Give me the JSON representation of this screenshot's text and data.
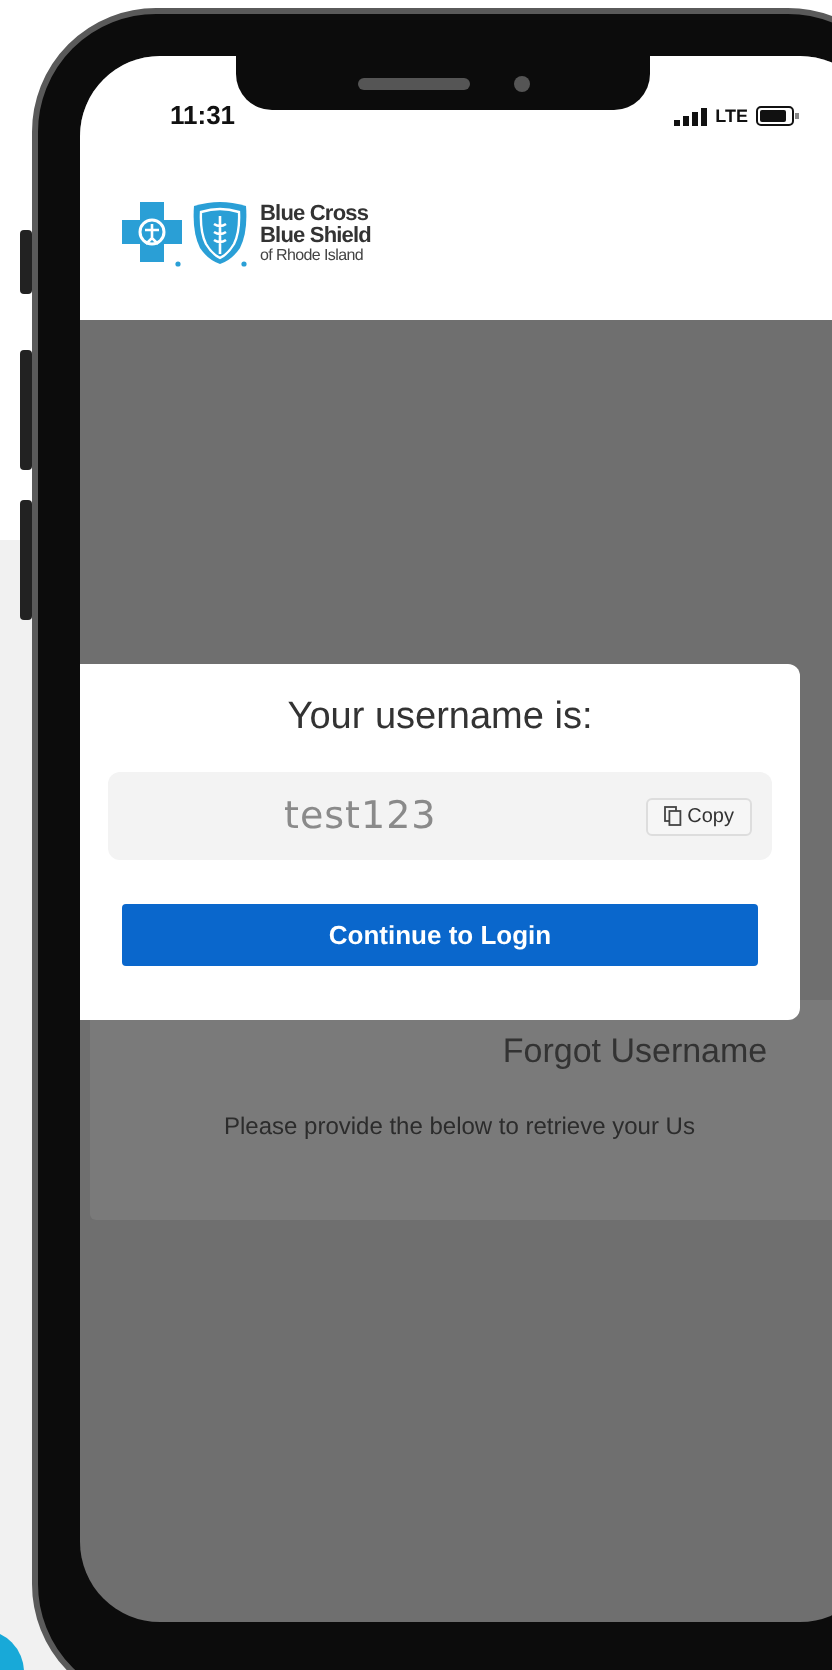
{
  "status_bar": {
    "time": "11:31",
    "network": "LTE"
  },
  "header": {
    "logo": {
      "line_1": "Blue Cross",
      "line_2": "Blue Shield",
      "line_3": "of Rhode Island"
    }
  },
  "background_form": {
    "title": "Forgot Username",
    "instructions": "Please provide the below to retrieve your Us"
  },
  "modal": {
    "title": "Your username is:",
    "username": "test123",
    "copy_button": "Copy",
    "continue_button": "Continue to Login"
  }
}
